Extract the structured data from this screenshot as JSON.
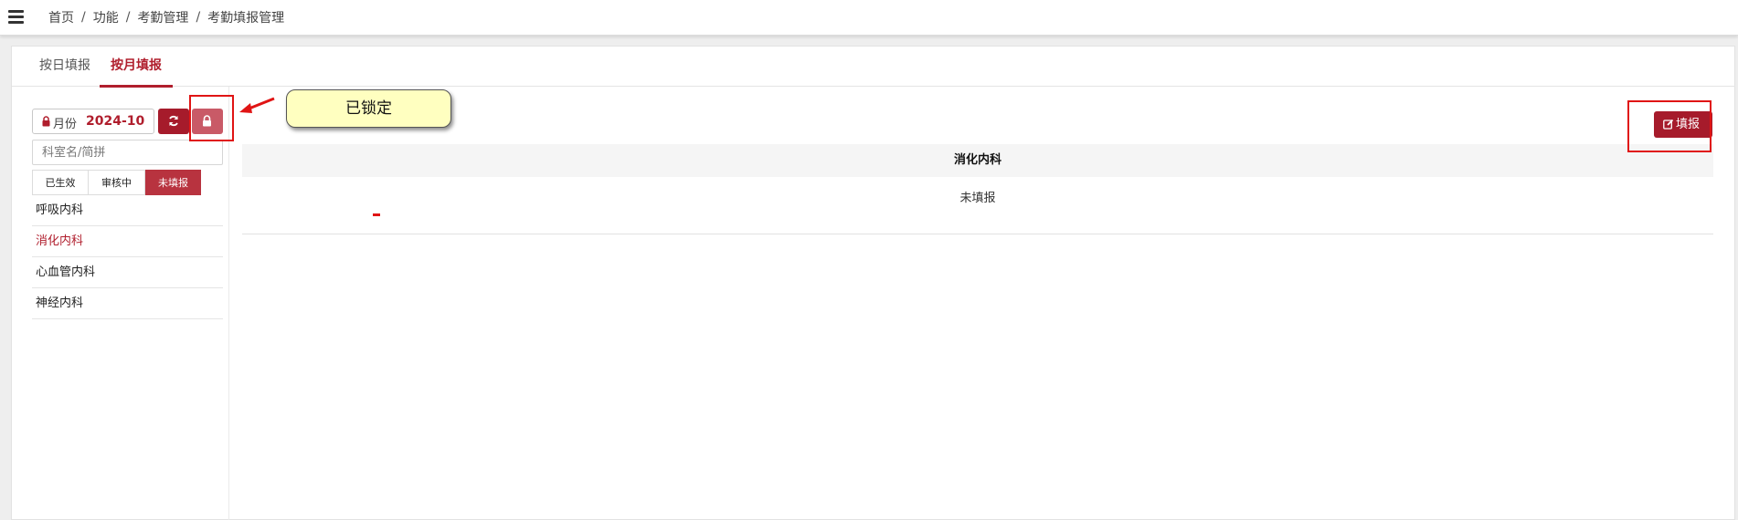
{
  "breadcrumb": [
    "首页",
    "功能",
    "考勤管理",
    "考勤填报管理"
  ],
  "tabs": [
    {
      "label": "按日填报",
      "active": false
    },
    {
      "label": "按月填报",
      "active": true
    }
  ],
  "month_picker": {
    "label": "月份",
    "value": "2024-10"
  },
  "search": {
    "placeholder": "科室名/简拼"
  },
  "filters": [
    {
      "label": "已生效",
      "active": false
    },
    {
      "label": "审核中",
      "active": false
    },
    {
      "label": "未填报",
      "active": true
    }
  ],
  "departments": [
    {
      "name": "呼吸内科",
      "active": false
    },
    {
      "name": "消化内科",
      "active": true
    },
    {
      "name": "心血管内科",
      "active": false
    },
    {
      "name": "神经内科",
      "active": false
    }
  ],
  "report_button": {
    "label": "填报"
  },
  "table": {
    "header": "消化内科",
    "status": "未填报"
  },
  "callout": {
    "text": "已锁定"
  },
  "colors": {
    "brand": "#a61b2b",
    "highlight": "#e01414",
    "callout_bg": "#ffffc0"
  },
  "icons": [
    "menu-icon",
    "lock-icon",
    "refresh-icon",
    "edit-icon"
  ]
}
